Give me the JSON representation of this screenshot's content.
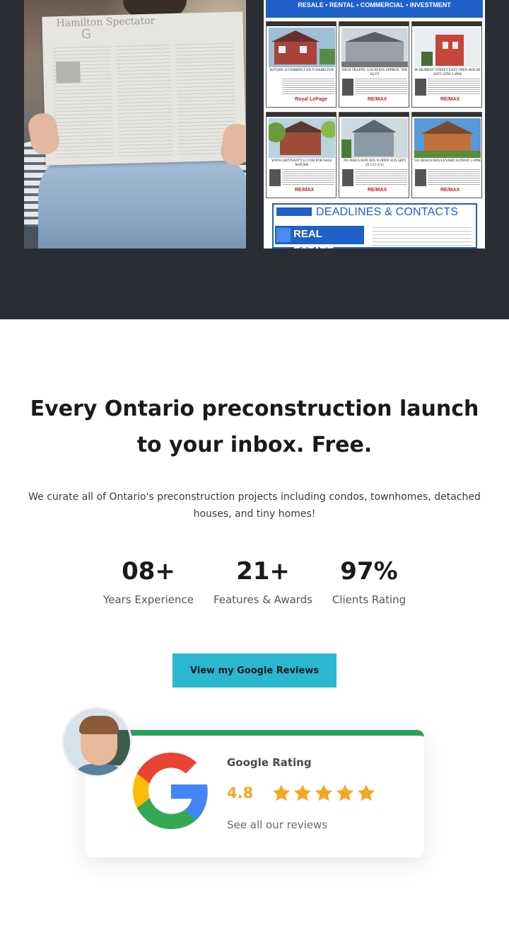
{
  "flyer": {
    "header_tagline": "RESALE • RENTAL • COMMERCIAL • INVESTMENT",
    "listings": [
      {
        "address": "$479,900 18 FAIRHOLT RD N HAMILTON",
        "brand": "Royal LePage"
      },
      {
        "address": "HIGH TRAFFIC LOCATION APPROX 7000 SQ FT",
        "brand": "RE/MAX"
      },
      {
        "address": "80 MURRAY STREET EAST OPEN HOUSE SEPT 29th 2-4PM",
        "brand": "RE/MAX"
      },
      {
        "address": "WWW.34DYNASTY11.COM FOR SALE $449,900",
        "brand": "RE/MAX"
      },
      {
        "address": "395 FERGUSON AVE N OPEN SUN SEPT 29 2:15-3:15",
        "brand": "RE/MAX"
      },
      {
        "address": "341 BEACH BOULEVARD SUNDAY 2-4PM",
        "brand": "RE/MAX"
      }
    ],
    "deadlines_title": "DEADLINES & CONTACTS",
    "section_label": "REAL ESTATE"
  },
  "main": {
    "headline": "Every Ontario preconstruction launch to your inbox. Free.",
    "subtext": "We curate all of Ontario's preconstruction projects including condos, townhomes, detached houses, and tiny homes!"
  },
  "stats": [
    {
      "value": "08+",
      "label": "Years Experience"
    },
    {
      "value": "21+",
      "label": "Features & Awards"
    },
    {
      "value": "97%",
      "label": "Clients Rating"
    }
  ],
  "cta": {
    "button_label": "View my Google Reviews"
  },
  "rating_card": {
    "title": "Google Rating",
    "value": "4.8",
    "stars": 5,
    "link_text": "See all our reviews",
    "accent_color": "#2aa05a",
    "star_color": "#f5a623"
  }
}
